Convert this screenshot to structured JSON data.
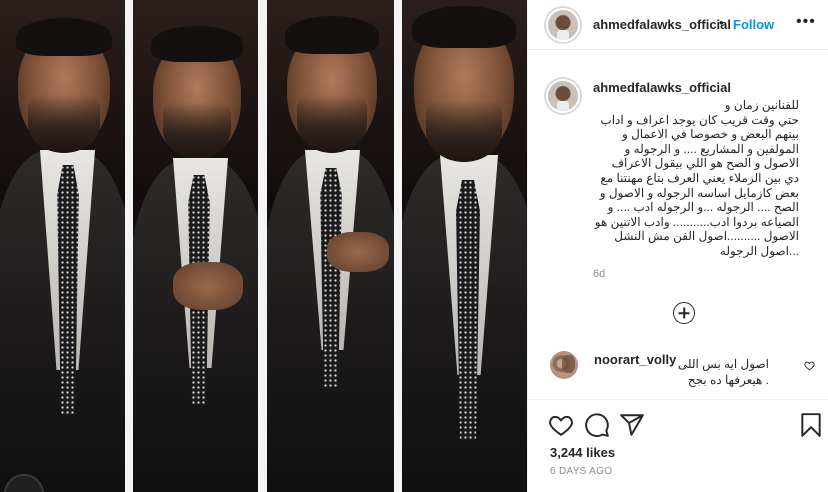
{
  "post": {
    "username": "ahmedfalawks_official",
    "dot": "•",
    "follow_label": "Follow",
    "more_label": "•••"
  },
  "caption": {
    "username": "ahmedfalawks_official",
    "lines": [
      "للفنانين زمان و",
      "حتي وقت قريب كان يوجد اعراف و اداب",
      "بينهم البعض و خصوصا في الاعمال و",
      "المولفين و المشاريع .... و الرجوله و",
      "الاصول و الصح هو اللي بيقول الاعراف",
      "دي بين الزملاء يعني العرف بتاع مهنتنا مع",
      "بعض كازمايل اساسه الرجوله و الاصول و",
      "الصح .... الرجوله ...و الرجوله ادب .... و",
      "الصياعه بردوا ادب........... وادب الاتنين هو",
      "الاصول ..........اصول الفن مش النشل",
      "...اصول الرجوله"
    ],
    "age": "6d"
  },
  "load_more": {
    "icon": "plus-circle-icon"
  },
  "comment": {
    "username": "noorart_volly",
    "lines": [
      "اصول ايه بس اللى",
      ". هيعرفها ده بجح"
    ],
    "like_icon": "heart-outline-icon"
  },
  "actions": {
    "like_icon": "heart-outline-icon",
    "comment_icon": "speech-bubble-icon",
    "share_icon": "paper-plane-icon",
    "save_icon": "bookmark-icon"
  },
  "likes": "3,244 likes",
  "timestamp": "6 DAYS AGO",
  "colors": {
    "follow_blue": "#0095f6",
    "muted_gray": "#8e8e8e",
    "border": "#efefef",
    "text": "#262626"
  }
}
